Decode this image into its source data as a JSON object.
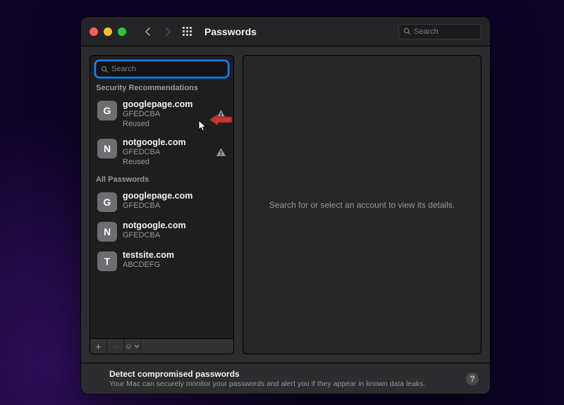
{
  "titlebar": {
    "title": "Passwords",
    "search_placeholder": "Search"
  },
  "sidebar": {
    "search_placeholder": "Search",
    "sections": [
      {
        "header": "Security Recommendations",
        "items": [
          {
            "initial": "G",
            "site": "googlepage.com",
            "user": "GFEDCBA",
            "tag": "Reused",
            "warn": true
          },
          {
            "initial": "N",
            "site": "notgoogle.com",
            "user": "GFEDCBA",
            "tag": "Reused",
            "warn": true
          }
        ]
      },
      {
        "header": "All Passwords",
        "items": [
          {
            "initial": "G",
            "site": "googlepage.com",
            "user": "GFEDCBA"
          },
          {
            "initial": "N",
            "site": "notgoogle.com",
            "user": "GFEDCBA"
          },
          {
            "initial": "T",
            "site": "testsite.com",
            "user": "ABCDEFG"
          }
        ]
      }
    ],
    "buttons": {
      "add": "+",
      "remove": "−",
      "more": "☺︎"
    }
  },
  "detail": {
    "empty_message": "Search for or select an account to view its details."
  },
  "footer": {
    "title": "Detect compromised passwords",
    "subtitle": "Your Mac can securely monitor your passwords and alert you if they appear in known data leaks.",
    "help": "?"
  },
  "colors": {
    "accent": "#0a84ff",
    "annotation_arrow": "#c0392b"
  }
}
